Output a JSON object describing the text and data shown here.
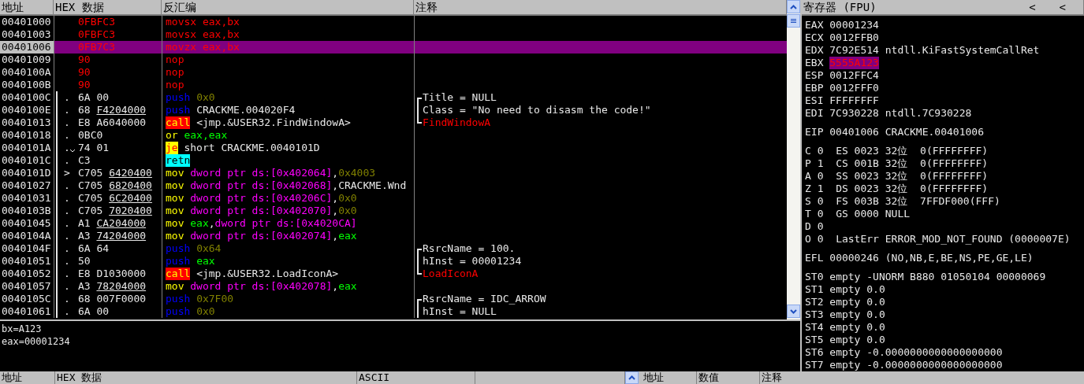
{
  "cpu": {
    "columns": [
      "地址",
      "HEX 数据",
      "反汇编",
      "注释"
    ],
    "rows": [
      {
        "address": "00401000",
        "selected": false,
        "proc": false,
        "hex": {
          "bytes": "0FBFC3",
          "modified": true
        },
        "mnemonic": {
          "text": "movsx",
          "kind": "modified"
        },
        "operands": [
          {
            "text": "eax,bx",
            "kind": "modified"
          }
        ]
      },
      {
        "address": "00401003",
        "selected": false,
        "proc": false,
        "hex": {
          "bytes": "0FBFC3",
          "modified": true
        },
        "mnemonic": {
          "text": "movsx",
          "kind": "modified"
        },
        "operands": [
          {
            "text": "eax,bx",
            "kind": "modified"
          }
        ]
      },
      {
        "address": "00401006",
        "selected": true,
        "proc": false,
        "hex": {
          "bytes": "0FB7C3",
          "modified": true
        },
        "mnemonic": {
          "text": "movzx",
          "kind": "modified"
        },
        "operands": [
          {
            "text": "eax,bx",
            "kind": "modified"
          }
        ]
      },
      {
        "address": "00401009",
        "selected": false,
        "proc": false,
        "hex": {
          "bytes": "90",
          "modified": true
        },
        "mnemonic": {
          "text": "nop",
          "kind": "modified"
        }
      },
      {
        "address": "0040100A",
        "selected": false,
        "proc": false,
        "hex": {
          "bytes": "90",
          "modified": true
        },
        "mnemonic": {
          "text": "nop",
          "kind": "modified"
        }
      },
      {
        "address": "0040100B",
        "selected": false,
        "proc": false,
        "hex": {
          "bytes": "90",
          "modified": true
        },
        "mnemonic": {
          "text": "nop",
          "kind": "modified"
        }
      },
      {
        "address": "0040100C",
        "selected": false,
        "proc": true,
        "mark": ".",
        "hex": {
          "bytes": "6A",
          "operand": "00",
          "fixup": false,
          "modified": false
        },
        "mnemonic": {
          "text": "push",
          "kind": "push"
        },
        "operands": [
          {
            "text": "0x0",
            "kind": "const"
          }
        ],
        "comment": {
          "text": "Title = NULL",
          "group_start": true,
          "group_end": false,
          "kind": "plain"
        }
      },
      {
        "address": "0040100E",
        "selected": false,
        "proc": true,
        "mark": ".",
        "hex": {
          "bytes": "68",
          "operand": "F4204000",
          "fixup": true,
          "modified": false
        },
        "mnemonic": {
          "text": "push",
          "kind": "push"
        },
        "operands": [
          {
            "text": "CRACKME.004020F4",
            "kind": "text"
          }
        ],
        "comment": {
          "text": "Class = \"No need to disasm the code!\"",
          "group_start": false,
          "group_end": false,
          "kind": "plain"
        }
      },
      {
        "address": "00401013",
        "selected": false,
        "proc": true,
        "mark": ".",
        "hex": {
          "bytes": "E8",
          "operand": "A6040000",
          "fixup": false,
          "modified": false
        },
        "mnemonic": {
          "text": "call",
          "kind": "call"
        },
        "operands": [
          {
            "text": "<jmp.&USER32.FindWindowA>",
            "kind": "text"
          }
        ],
        "comment": {
          "text": "FindWindowA",
          "group_start": false,
          "group_end": true,
          "kind": "api"
        }
      },
      {
        "address": "00401018",
        "selected": false,
        "proc": true,
        "mark": ".",
        "hex": {
          "bytes": "0BC0",
          "modified": false
        },
        "mnemonic": {
          "text": "or",
          "kind": "mov"
        },
        "operands": [
          {
            "text": "eax,eax",
            "kind": "reg"
          }
        ]
      },
      {
        "address": "0040101A",
        "selected": false,
        "proc": true,
        "mark": ".",
        "jump_down": true,
        "hex": {
          "bytes": "74",
          "operand": "01",
          "fixup": false,
          "modified": false
        },
        "mnemonic": {
          "text": "je",
          "kind": "jcc"
        },
        "operands": [
          {
            "text": "short CRACKME.0040101D",
            "kind": "text"
          }
        ]
      },
      {
        "address": "0040101C",
        "selected": false,
        "proc": true,
        "mark": ".",
        "hex": {
          "bytes": "C3",
          "modified": false
        },
        "mnemonic": {
          "text": "retn",
          "kind": "ret"
        }
      },
      {
        "address": "0040101D",
        "selected": false,
        "proc": true,
        "mark": ">",
        "hex": {
          "bytes": "C705",
          "operand": "6420400",
          "fixup": true,
          "modified": false
        },
        "mnemonic": {
          "text": "mov",
          "kind": "mov"
        },
        "operands": [
          {
            "text": "dword ptr ds:[0x402064]",
            "kind": "mem"
          },
          {
            "text": ",",
            "kind": "text"
          },
          {
            "text": "0x4003",
            "kind": "const"
          }
        ]
      },
      {
        "address": "00401027",
        "selected": false,
        "proc": true,
        "mark": ".",
        "hex": {
          "bytes": "C705",
          "operand": "6820400",
          "fixup": true,
          "modified": false
        },
        "mnemonic": {
          "text": "mov",
          "kind": "mov"
        },
        "operands": [
          {
            "text": "dword ptr ds:[0x402068]",
            "kind": "mem"
          },
          {
            "text": ",CRACKME.Wnd",
            "kind": "text"
          }
        ]
      },
      {
        "address": "00401031",
        "selected": false,
        "proc": true,
        "mark": ".",
        "hex": {
          "bytes": "C705",
          "operand": "6C20400",
          "fixup": true,
          "modified": false
        },
        "mnemonic": {
          "text": "mov",
          "kind": "mov"
        },
        "operands": [
          {
            "text": "dword ptr ds:[0x40206C]",
            "kind": "mem"
          },
          {
            "text": ",",
            "kind": "text"
          },
          {
            "text": "0x0",
            "kind": "const"
          }
        ]
      },
      {
        "address": "0040103B",
        "selected": false,
        "proc": true,
        "mark": ".",
        "hex": {
          "bytes": "C705",
          "operand": "7020400",
          "fixup": true,
          "modified": false
        },
        "mnemonic": {
          "text": "mov",
          "kind": "mov"
        },
        "operands": [
          {
            "text": "dword ptr ds:[0x402070]",
            "kind": "mem"
          },
          {
            "text": ",",
            "kind": "text"
          },
          {
            "text": "0x0",
            "kind": "const"
          }
        ]
      },
      {
        "address": "00401045",
        "selected": false,
        "proc": true,
        "mark": ".",
        "hex": {
          "bytes": "A1",
          "operand": "CA204000",
          "fixup": true,
          "modified": false
        },
        "mnemonic": {
          "text": "mov",
          "kind": "mov"
        },
        "operands": [
          {
            "text": "eax",
            "kind": "reg"
          },
          {
            "text": ",",
            "kind": "text"
          },
          {
            "text": "dword ptr ds:[0x4020CA]",
            "kind": "mem"
          }
        ]
      },
      {
        "address": "0040104A",
        "selected": false,
        "proc": true,
        "mark": ".",
        "hex": {
          "bytes": "A3",
          "operand": "74204000",
          "fixup": true,
          "modified": false
        },
        "mnemonic": {
          "text": "mov",
          "kind": "mov"
        },
        "operands": [
          {
            "text": "dword ptr ds:[0x402074]",
            "kind": "mem"
          },
          {
            "text": ",",
            "kind": "text"
          },
          {
            "text": "eax",
            "kind": "reg"
          }
        ]
      },
      {
        "address": "0040104F",
        "selected": false,
        "proc": true,
        "mark": ".",
        "hex": {
          "bytes": "6A",
          "operand": "64",
          "fixup": false,
          "modified": false
        },
        "mnemonic": {
          "text": "push",
          "kind": "push"
        },
        "operands": [
          {
            "text": "0x64",
            "kind": "const"
          }
        ],
        "comment": {
          "text": "RsrcName = 100.",
          "group_start": true,
          "group_end": false,
          "kind": "plain"
        }
      },
      {
        "address": "00401051",
        "selected": false,
        "proc": true,
        "mark": ".",
        "hex": {
          "bytes": "50",
          "modified": false
        },
        "mnemonic": {
          "text": "push",
          "kind": "push"
        },
        "operands": [
          {
            "text": "eax",
            "kind": "reg"
          }
        ],
        "comment": {
          "text": "hInst = 00001234",
          "group_start": false,
          "group_end": false,
          "kind": "plain"
        }
      },
      {
        "address": "00401052",
        "selected": false,
        "proc": true,
        "mark": ".",
        "hex": {
          "bytes": "E8",
          "operand": "D1030000",
          "fixup": false,
          "modified": false
        },
        "mnemonic": {
          "text": "call",
          "kind": "call"
        },
        "operands": [
          {
            "text": "<jmp.&USER32.LoadIconA>",
            "kind": "text"
          }
        ],
        "comment": {
          "text": "LoadIconA",
          "group_start": false,
          "group_end": true,
          "kind": "api"
        }
      },
      {
        "address": "00401057",
        "selected": false,
        "proc": true,
        "mark": ".",
        "hex": {
          "bytes": "A3",
          "operand": "78204000",
          "fixup": true,
          "modified": false
        },
        "mnemonic": {
          "text": "mov",
          "kind": "mov"
        },
        "operands": [
          {
            "text": "dword ptr ds:[0x402078]",
            "kind": "mem"
          },
          {
            "text": ",",
            "kind": "text"
          },
          {
            "text": "eax",
            "kind": "reg"
          }
        ]
      },
      {
        "address": "0040105C",
        "selected": false,
        "proc": true,
        "mark": ".",
        "hex": {
          "bytes": "68",
          "operand": "007F0000",
          "fixup": false,
          "modified": false
        },
        "mnemonic": {
          "text": "push",
          "kind": "push"
        },
        "operands": [
          {
            "text": "0x7F00",
            "kind": "const"
          }
        ],
        "comment": {
          "text": "RsrcName = IDC_ARROW",
          "group_start": true,
          "group_end": false,
          "kind": "plain"
        }
      },
      {
        "address": "00401061",
        "selected": false,
        "proc": true,
        "mark": ".",
        "hex": {
          "bytes": "6A",
          "operand": "00",
          "fixup": false,
          "modified": false
        },
        "mnemonic": {
          "text": "push",
          "kind": "push"
        },
        "operands": [
          {
            "text": "0x0",
            "kind": "const"
          }
        ],
        "comment": {
          "text": "hInst = NULL",
          "group_start": false,
          "group_end": false,
          "kind": "plain"
        }
      }
    ]
  },
  "registers": {
    "title": "寄存器 (FPU)",
    "buttons": [
      "<",
      "<"
    ],
    "groups": [
      {
        "kind": "registers",
        "items": [
          {
            "name": "EAX",
            "value": "00001234",
            "changed": false
          },
          {
            "name": "ECX",
            "value": "0012FFB0",
            "changed": false
          },
          {
            "name": "EDX",
            "value": "7C92E514",
            "changed": false,
            "info": "ntdll.KiFastSystemCallRet"
          },
          {
            "name": "EBX",
            "value": "5555A123",
            "changed": true
          },
          {
            "name": "ESP",
            "value": "0012FFC4",
            "changed": false
          },
          {
            "name": "EBP",
            "value": "0012FFF0",
            "changed": false
          },
          {
            "name": "ESI",
            "value": "FFFFFFFF",
            "changed": false
          },
          {
            "name": "EDI",
            "value": "7C930228",
            "changed": false,
            "info": "ntdll.7C930228"
          }
        ]
      },
      {
        "kind": "registers",
        "items": [
          {
            "name": "EIP",
            "value": "00401006",
            "changed": false,
            "info": "CRACKME.00401006"
          }
        ]
      },
      {
        "kind": "lines",
        "items": [
          "C 0  ES 0023 32位  0(FFFFFFFF)",
          "P 1  CS 001B 32位  0(FFFFFFFF)",
          "A 0  SS 0023 32位  0(FFFFFFFF)",
          "Z 1  DS 0023 32位  0(FFFFFFFF)",
          "S 0  FS 003B 32位  7FFDF000(FFF)",
          "T 0  GS 0000 NULL",
          "D 0",
          "O 0  LastErr ERROR_MOD_NOT_FOUND (0000007E)"
        ]
      },
      {
        "kind": "lines",
        "items": [
          "EFL 00000246 (NO,NB,E,BE,NS,PE,GE,LE)"
        ]
      },
      {
        "kind": "lines",
        "items": [
          "ST0 empty -UNORM B880 01050104 00000069",
          "ST1 empty 0.0",
          "ST2 empty 0.0",
          "ST3 empty 0.0",
          "ST4 empty 0.0",
          "ST5 empty 0.0",
          "ST6 empty -0.0000000000000000000",
          "ST7 empty -0.0000000000000000000"
        ]
      }
    ]
  },
  "info": {
    "lines": [
      "bx=A123",
      "eax=00001234"
    ]
  },
  "dump": {
    "columns": [
      "地址",
      "HEX 数据",
      "ASCII"
    ]
  },
  "stack": {
    "columns": [
      "地址",
      "数值",
      "注释"
    ]
  }
}
